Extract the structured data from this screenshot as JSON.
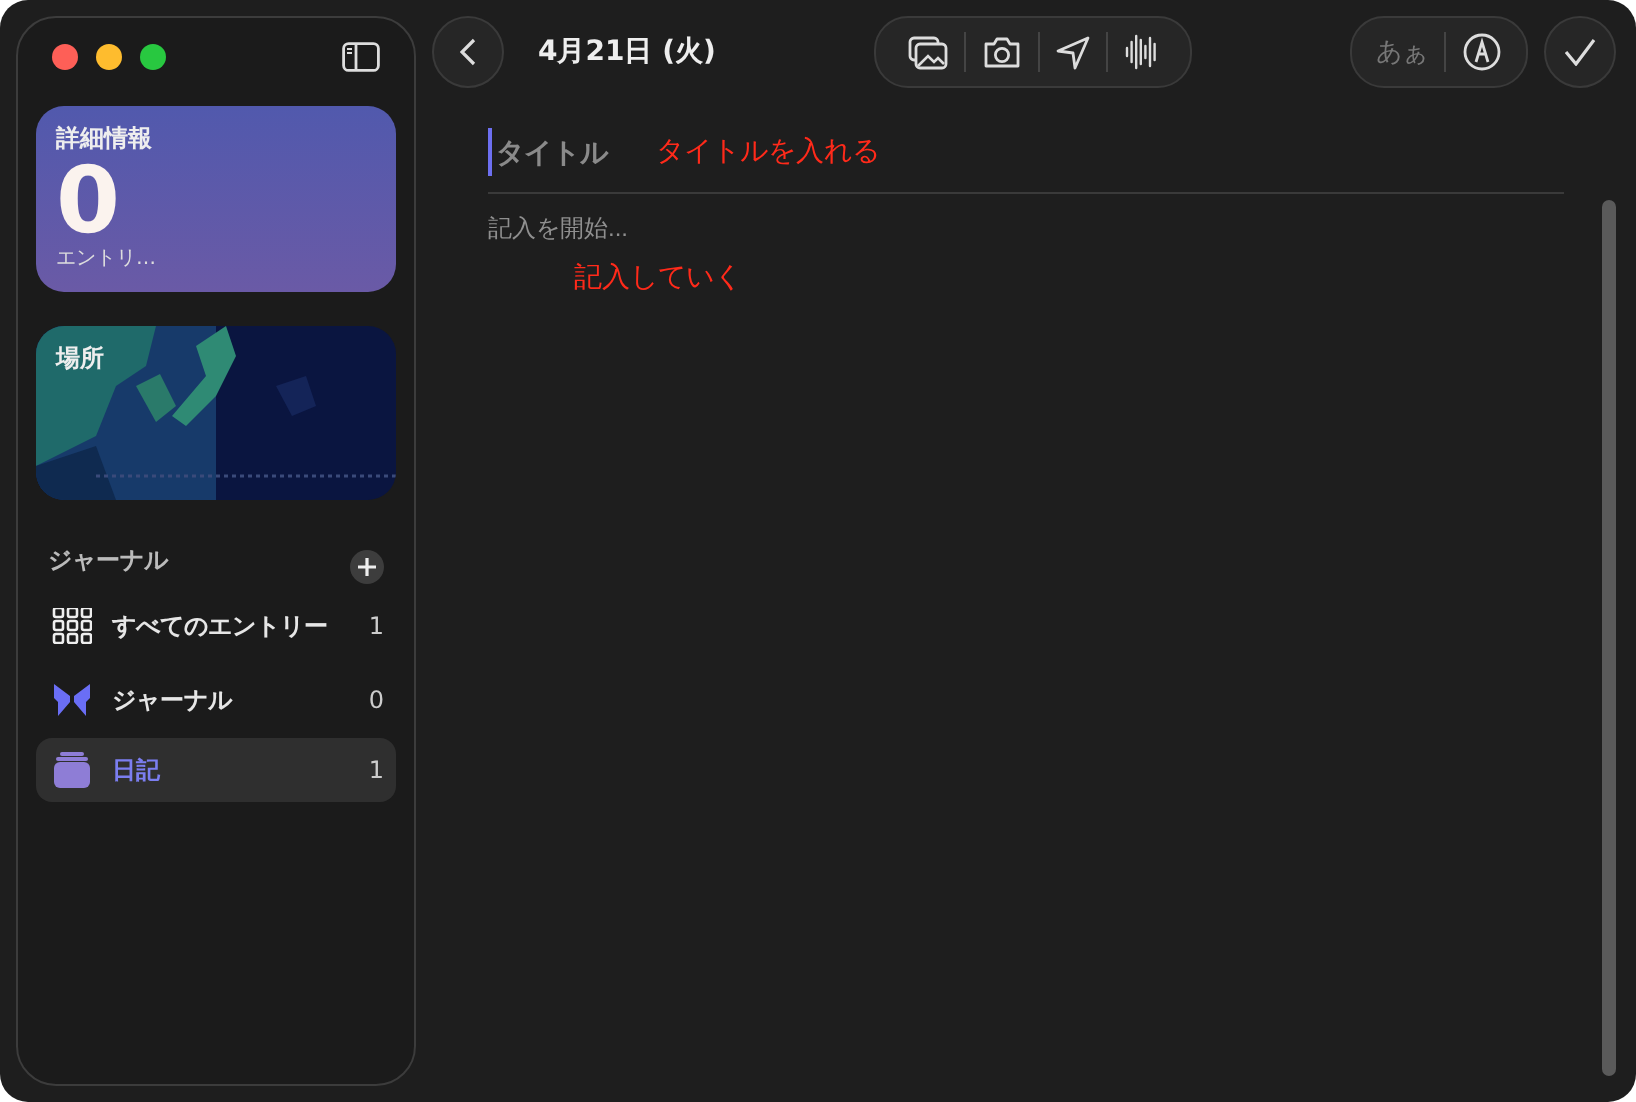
{
  "sidebar": {
    "details_card": {
      "title": "詳細情報",
      "count": "0",
      "caption": "エントリ…"
    },
    "places_card": {
      "title": "場所",
      "kind": "picture"
    },
    "section": {
      "title": "ジャーナル"
    },
    "items": [
      {
        "kind": "grid",
        "label": "すべてのエントリー",
        "count": "1",
        "selected": false
      },
      {
        "kind": "butterfly",
        "label": "ジャーナル",
        "count": "0",
        "selected": false
      },
      {
        "kind": "stack",
        "label": "日記",
        "count": "1",
        "selected": true
      }
    ]
  },
  "toolbar": {
    "date": "4月21日 (火)",
    "text_style": "あぁ"
  },
  "editor": {
    "title_placeholder": "タイトル",
    "title_note": "タイトルを入れる",
    "body_placeholder": "記入を開始...",
    "body_note": "記入していく"
  }
}
